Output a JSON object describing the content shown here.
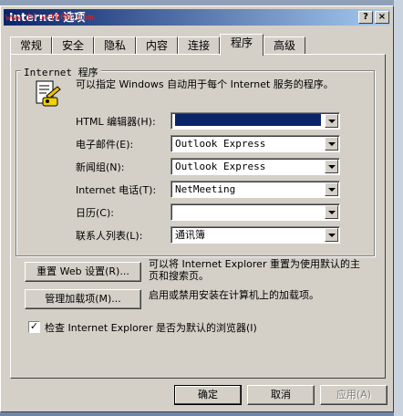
{
  "watermark": "www.blue1000.com",
  "window": {
    "title": "Internet 选项",
    "help_label": "?",
    "close_label": "×"
  },
  "tabs": [
    {
      "label": "常规"
    },
    {
      "label": "安全"
    },
    {
      "label": "隐私"
    },
    {
      "label": "内容"
    },
    {
      "label": "连接"
    },
    {
      "label": "程序",
      "active": true
    },
    {
      "label": "高级"
    }
  ],
  "programs": {
    "group_title": "Internet 程序",
    "description": "可以指定 Windows 自动用于每个 Internet 服务的程序。",
    "rows": [
      {
        "label": "HTML 编辑器(H):",
        "value": ""
      },
      {
        "label": "电子邮件(E):",
        "value": "Outlook Express"
      },
      {
        "label": "新闻组(N):",
        "value": "Outlook Express"
      },
      {
        "label": "Internet 电话(T):",
        "value": "NetMeeting"
      },
      {
        "label": "日历(C):",
        "value": ""
      },
      {
        "label": "联系人列表(L):",
        "value": "通讯簿"
      }
    ]
  },
  "reset": {
    "button": "重置 Web 设置(R)...",
    "help": "可以将 Internet Explorer 重置为使用默认的主页和搜索页。"
  },
  "addons": {
    "button": "管理加载项(M)...",
    "help": "启用或禁用安装在计算机上的加载项。"
  },
  "default_check": {
    "checked": true,
    "mark": "✓",
    "label": "检查 Internet Explorer 是否为默认的浏览器(I)"
  },
  "footer": {
    "ok": "确定",
    "cancel": "取消",
    "apply": "应用(A)"
  }
}
